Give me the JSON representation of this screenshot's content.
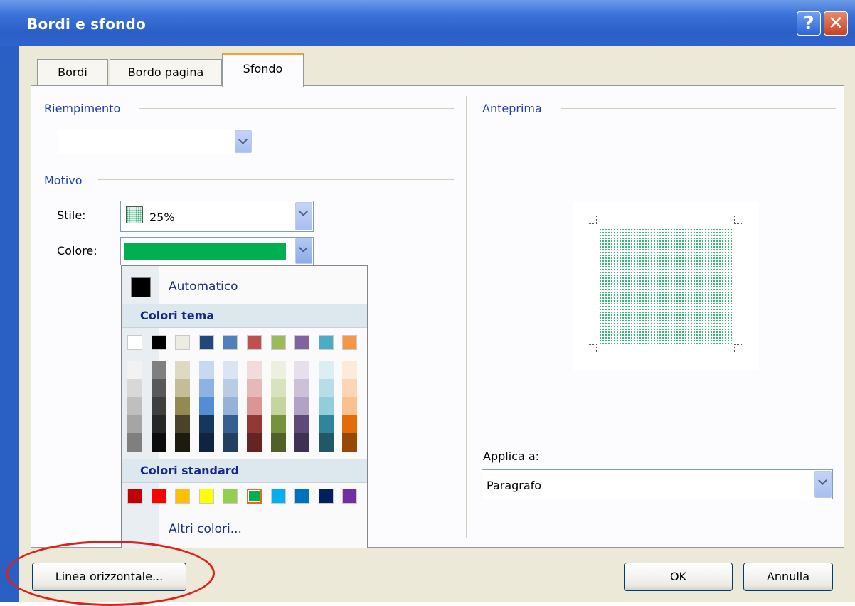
{
  "window": {
    "title": "Bordi e sfondo",
    "help_label": "?",
    "close_label": "✕"
  },
  "tabs": [
    {
      "label": "Bordi",
      "active": false
    },
    {
      "label": "Bordo pagina",
      "active": false
    },
    {
      "label": "Sfondo",
      "active": true
    }
  ],
  "fill": {
    "group_label": "Riempimento",
    "value": ""
  },
  "pattern": {
    "group_label": "Motivo",
    "style_label": "Stile:",
    "style_value": "25%",
    "color_label": "Colore:",
    "color_value": "#00b050"
  },
  "preview": {
    "group_label": "Anteprima",
    "shade_color": "#3db37a"
  },
  "apply": {
    "label": "Applica a:",
    "value": "Paragrafo"
  },
  "color_popup": {
    "automatic_label": "Automatico",
    "automatic_color": "#000000",
    "theme_label": "Colori tema",
    "theme_colors": [
      "#ffffff",
      "#000000",
      "#eeece1",
      "#1f497d",
      "#4f81bd",
      "#c0504d",
      "#9bbb59",
      "#8064a2",
      "#4bacc6",
      "#f79646"
    ],
    "theme_tints": [
      [
        "#f2f2f2",
        "#d8d8d8",
        "#bfbfbf",
        "#a5a5a5",
        "#7f7f7f"
      ],
      [
        "#7f7f7f",
        "#595959",
        "#3f3f3f",
        "#262626",
        "#0c0c0c"
      ],
      [
        "#ddd9c3",
        "#c4bd97",
        "#938953",
        "#494429",
        "#1d1b10"
      ],
      [
        "#c6d9f0",
        "#8db3e2",
        "#548dd4",
        "#17365d",
        "#0f243e"
      ],
      [
        "#dbe5f1",
        "#b8cce4",
        "#95b3d7",
        "#366092",
        "#244061"
      ],
      [
        "#f2dcdb",
        "#e5b9b7",
        "#d99694",
        "#953734",
        "#632423"
      ],
      [
        "#ebf1dd",
        "#d7e3bc",
        "#c3d69b",
        "#76923c",
        "#4f6128"
      ],
      [
        "#e5e0ec",
        "#ccc1d9",
        "#b2a2c7",
        "#5f497a",
        "#3f3151"
      ],
      [
        "#dbeef3",
        "#b7dde8",
        "#92cddc",
        "#31859b",
        "#205867"
      ],
      [
        "#fdeada",
        "#fbd5b5",
        "#fac08f",
        "#e36c09",
        "#974806"
      ]
    ],
    "standard_label": "Colori standard",
    "standard_colors": [
      "#c00000",
      "#ff0000",
      "#ffc000",
      "#ffff00",
      "#92d050",
      "#00b050",
      "#00b0f0",
      "#0070c0",
      "#002060",
      "#7030a0"
    ],
    "selected_index": 5,
    "more_label": "Altri colori..."
  },
  "buttons": {
    "horizontal_line": "Linea orizzontale...",
    "ok": "OK",
    "cancel": "Annulla"
  },
  "highlight_color": "#e0201b"
}
